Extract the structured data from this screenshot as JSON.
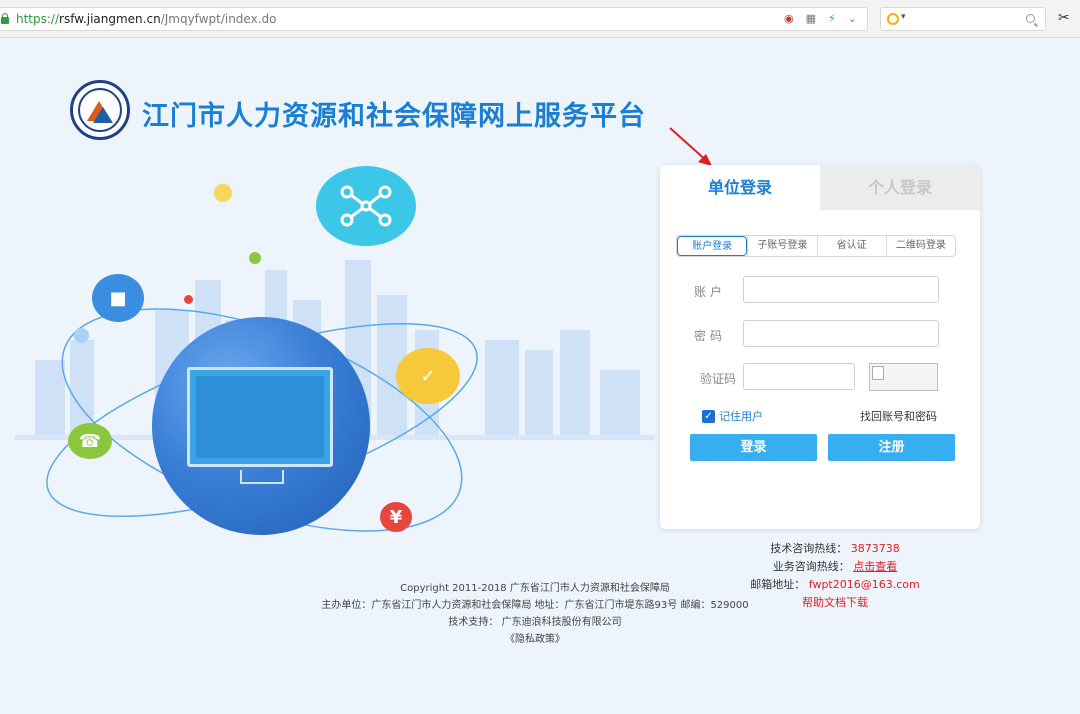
{
  "browser": {
    "url_scheme": "https://",
    "url_host": "rsfw.jiangmen.cn",
    "url_path": "/Jmqyfwpt/index.do"
  },
  "header": {
    "title": "江门市人力资源和社会保障网上服务平台"
  },
  "login": {
    "tabs": [
      {
        "label": "单位登录",
        "active": true
      },
      {
        "label": "个人登录",
        "active": false
      }
    ],
    "subtabs": [
      {
        "label": "账户登录",
        "active": true
      },
      {
        "label": "子账号登录",
        "active": false
      },
      {
        "label": "省认证",
        "active": false
      },
      {
        "label": "二维码登录",
        "active": false
      }
    ],
    "account_label": "账户",
    "password_label": "密码",
    "captcha_label": "验证码",
    "account_value": "",
    "password_value": "",
    "captcha_value": "",
    "remember_label": "记住用户",
    "remember_checked": true,
    "recover_link": "找回账号和密码",
    "login_button": "登录",
    "register_button": "注册"
  },
  "contact": {
    "tech_hotline_label": "技术咨询热线：",
    "tech_hotline_value": "3873738",
    "business_hotline_label": "业务咨询热线：",
    "business_hotline_link": "点击查看",
    "email_label": "邮箱地址：",
    "email_value": "fwpt2016@163.com",
    "help_doc_link": "帮助文档下载"
  },
  "footer": {
    "copyright": "Copyright 2011-2018 广东省江门市人力资源和社会保障局",
    "host_unit": "主办单位：广东省江门市人力资源和社会保障局 地址：广东省江门市堤东路93号 邮编：529000",
    "tech_support": "技术支持： 广东迪浪科技股份有限公司",
    "privacy": "《隐私政策》"
  },
  "colors": {
    "primary": "#1a7fd4",
    "button": "#37adf2",
    "alert_red": "#e02020",
    "background": "#eef4fc"
  }
}
